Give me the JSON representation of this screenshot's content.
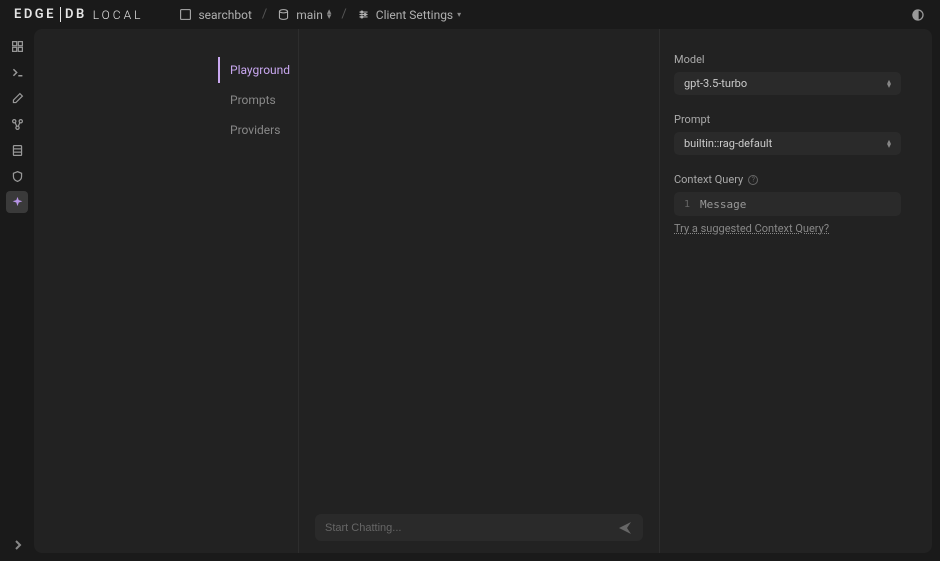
{
  "logo": {
    "part1": "EDGE",
    "part2": "DB",
    "part3": "LOCAL"
  },
  "breadcrumb": {
    "project": "searchbot",
    "branch": "main",
    "page": "Client Settings"
  },
  "sidebar_nav": {
    "items": [
      {
        "label": "Playground",
        "active": true
      },
      {
        "label": "Prompts",
        "active": false
      },
      {
        "label": "Providers",
        "active": false
      }
    ]
  },
  "chat": {
    "placeholder": "Start Chatting..."
  },
  "settings": {
    "model": {
      "label": "Model",
      "value": "gpt-3.5-turbo"
    },
    "prompt": {
      "label": "Prompt",
      "value": "builtin::rag-default"
    },
    "context_query": {
      "label": "Context Query",
      "line_number": "1",
      "value": "Message",
      "suggest_link": "Try a suggested Context Query?"
    }
  }
}
